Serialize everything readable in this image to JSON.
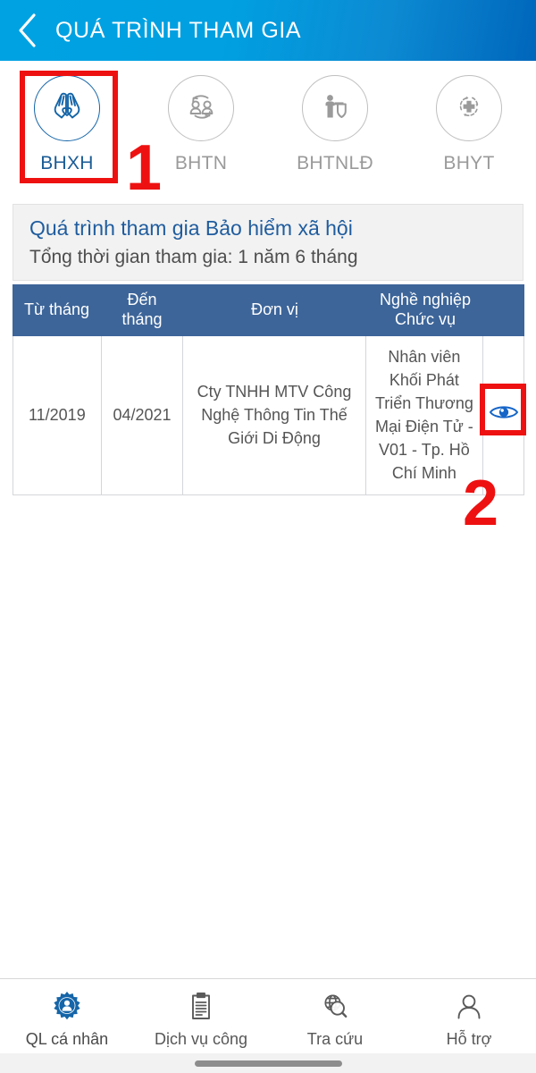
{
  "header": {
    "title": "QUÁ TRÌNH THAM GIA",
    "back_icon": "chevron-left-icon",
    "gradient_from": "#00a2e2",
    "gradient_to": "#0066bb"
  },
  "tabs": [
    {
      "label": "BHXH",
      "icon": "praying-hands-heart-icon",
      "active": true,
      "color": "#1b5c96"
    },
    {
      "label": "BHTN",
      "icon": "two-people-cycle-icon",
      "active": false,
      "color": "#9a9a9a"
    },
    {
      "label": "BHTNLĐ",
      "icon": "worker-shield-icon",
      "active": false,
      "color": "#9a9a9a"
    },
    {
      "label": "BHYT",
      "icon": "medical-cross-cycle-icon",
      "active": false,
      "color": "#9a9a9a"
    }
  ],
  "info": {
    "title": "Quá trình tham gia Bảo hiểm xã hội",
    "subtitle": "Tổng thời gian tham gia: 1 năm 6 tháng",
    "title_color": "#1f5c9e"
  },
  "table": {
    "header_color": "#3d6599",
    "columns": [
      "Từ tháng",
      "Đến tháng",
      "Đơn vị",
      "Nghề nghiệp\nChức vụ",
      ""
    ],
    "columns_multiline": {
      "col2_line1": "Đến",
      "col2_line2": "tháng",
      "col4_line1": "Nghề nghiệp",
      "col4_line2": "Chức vụ"
    },
    "rows": [
      {
        "tu_thang": "11/2019",
        "den_thang": "04/2021",
        "don_vi": "Cty TNHH MTV Công Nghệ Thông Tin Thế Giới Di Động",
        "nghe_nghiep": "Nhân viên Khối Phát Triển Thương Mại Điện Tử - V01 - Tp. Hồ Chí Minh",
        "action_icon": "eye-icon"
      }
    ]
  },
  "annotations": [
    {
      "number": "1",
      "target": "tab-bhxh",
      "color": "#ee1111"
    },
    {
      "number": "2",
      "target": "row-eye-icon",
      "color": "#ee1111"
    }
  ],
  "bottom_nav": [
    {
      "label": "QL cá nhân",
      "icon": "gear-person-icon",
      "active": true
    },
    {
      "label": "Dịch vụ công",
      "icon": "document-icon",
      "active": false
    },
    {
      "label": "Tra cứu",
      "icon": "globe-search-icon",
      "active": false
    },
    {
      "label": "Hỗ trợ",
      "icon": "headset-person-icon",
      "active": false
    }
  ]
}
